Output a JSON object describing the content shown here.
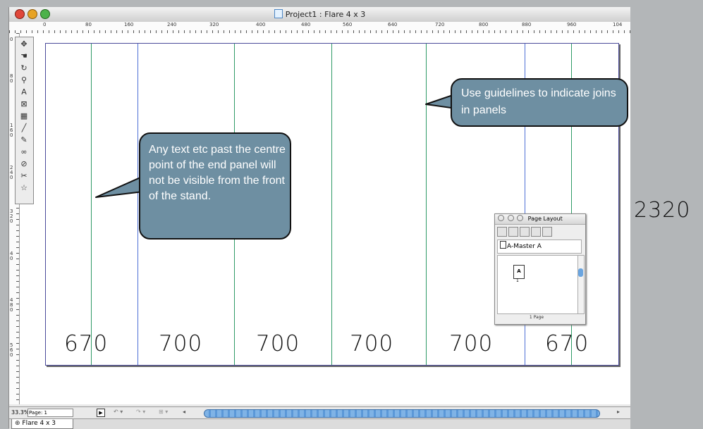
{
  "window": {
    "title": "Project1 : Flare 4 x 3",
    "traffic_lights": {
      "close": "#e0473a",
      "minimize": "#e7a325",
      "zoom": "#4cb24a"
    }
  },
  "ruler": {
    "h_ticks": [
      "0",
      "80",
      "160",
      "240",
      "320",
      "400",
      "480",
      "560",
      "640",
      "720",
      "800",
      "880",
      "960",
      "104"
    ],
    "v_ticks": [
      "0",
      "8 0",
      "1 6 0",
      "2 4 0",
      "3 2 0",
      "4 0",
      "4 8 0",
      "5 6 0"
    ]
  },
  "tools": [
    "move-icon",
    "grab-icon",
    "rotate-icon",
    "zoom-icon",
    "text-box-icon",
    "picture-box-icon",
    "table-icon",
    "line-icon",
    "pen-icon",
    "link-icon",
    "unlink-icon",
    "scissors-icon",
    "star-icon"
  ],
  "tool_glyphs": [
    "✥",
    "☚",
    "↻",
    "⚲",
    "A",
    "⊠",
    "▦",
    "╱",
    "✎",
    "∞",
    "⊘",
    "✂",
    "☆"
  ],
  "panel_widths": [
    "670",
    "700",
    "700",
    "700",
    "700",
    "670"
  ],
  "total_width": "2320",
  "callouts": {
    "left": "Any text etc past the centre point of the end panel will not be visible from the front of the stand.",
    "right": "Use guidelines to indicate joins in panels"
  },
  "page_layout": {
    "title": "Page Layout",
    "master": "A-Master A",
    "thumb_letter": "A",
    "page_number": "1",
    "count": "1 Page"
  },
  "status": {
    "zoom": "33.3%",
    "page_label": "Page: 1"
  },
  "tab": {
    "label": "Flare 4 x 3"
  },
  "colors": {
    "callout": "#6e8fa2",
    "guide_green": "#2f9a66",
    "guide_blue": "#4d6fd6"
  }
}
